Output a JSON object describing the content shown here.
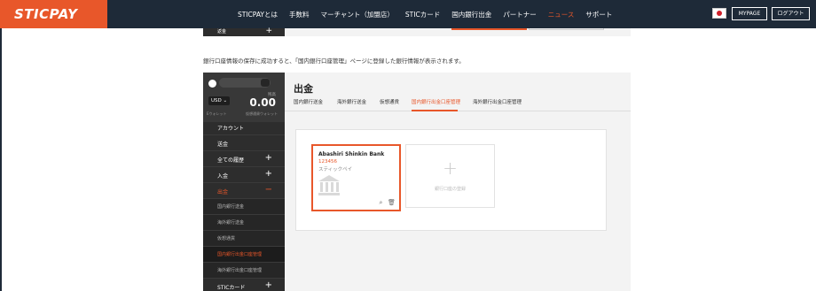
{
  "header": {
    "logo": "STICPAY",
    "nav": [
      {
        "label": "STICPAYとは"
      },
      {
        "label": "手数料"
      },
      {
        "label": "マーチャント（加盟店）"
      },
      {
        "label": "STICカード"
      },
      {
        "label": "国内銀行出金"
      },
      {
        "label": "パートナー"
      },
      {
        "label": "ニュース",
        "active": true
      },
      {
        "label": "サポート"
      }
    ],
    "mypage": "MYPAGE",
    "logout": "ログアウト"
  },
  "top_cut": {
    "sidebar_label": "返金",
    "plus": "+"
  },
  "description": "銀行口座情報の保存に成功すると、「国内銀行口座管理」ページに登録した銀行情報が表示されます。",
  "sidebar": {
    "currency": "USD ⌄",
    "balance_label": "残高",
    "balance": "0.00",
    "sub1": "Eウォレット",
    "sub2": "仮想通貨ウォレット",
    "items": [
      {
        "label": "アカウント",
        "pm": ""
      },
      {
        "label": "送金",
        "pm": ""
      },
      {
        "label": "全ての履歴",
        "pm": "+"
      },
      {
        "label": "入金",
        "pm": "+"
      },
      {
        "label": "出金",
        "pm": "−"
      },
      {
        "label": "国内銀行送金",
        "pm": ""
      },
      {
        "label": "海外銀行送金",
        "pm": ""
      },
      {
        "label": "仮想通貨",
        "pm": ""
      },
      {
        "label": "国内銀行出金口座管理",
        "pm": ""
      },
      {
        "label": "海外銀行出金口座管理",
        "pm": ""
      },
      {
        "label": "STICカード",
        "pm": "+"
      }
    ]
  },
  "main": {
    "title": "出金",
    "tabs": [
      {
        "label": "国内銀行送金"
      },
      {
        "label": "海外銀行送金"
      },
      {
        "label": "仮想通貨"
      },
      {
        "label": "国内銀行出金口座管理",
        "active": true
      },
      {
        "label": "海外銀行出金口座管理"
      }
    ]
  },
  "bank_card": {
    "bank_name": "Abashiri Shinkin Bank",
    "account_number": "123456",
    "holder": "スティックペイ"
  },
  "add_card": {
    "plus": "+",
    "label": "銀行口座の登録"
  },
  "colors": {
    "accent": "#e8572a",
    "nav_bg": "#1e2a38",
    "sidebar_bg": "#2d2d2d"
  }
}
